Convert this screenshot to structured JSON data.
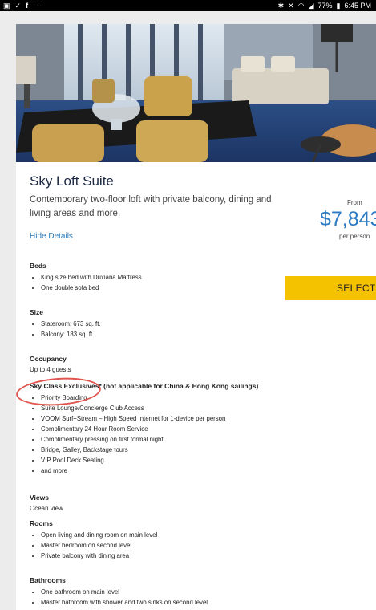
{
  "status_bar": {
    "left_icons": [
      "gallery-icon",
      "check-icon",
      "facebook-icon",
      "more-icon"
    ],
    "right_icons": [
      "bluetooth-icon",
      "mute-icon",
      "wifi-icon",
      "signal-icon"
    ],
    "battery": "77%",
    "time": "6:45 PM"
  },
  "suite": {
    "title": "Sky Loft Suite",
    "description": "Contemporary two-floor loft with private balcony, dining and living areas and more.",
    "hide_details": "Hide Details"
  },
  "pricing": {
    "from": "From",
    "price": "$7,843",
    "per": "per person",
    "select": "SELECT"
  },
  "details": {
    "beds": {
      "heading": "Beds",
      "items": [
        "King size bed with Duxiana Mattress",
        "One double sofa bed"
      ]
    },
    "size": {
      "heading": "Size",
      "items": [
        "Stateroom: 673 sq. ft.",
        "Balcony: 183 sq. ft."
      ]
    },
    "occupancy": {
      "heading": "Occupancy",
      "value": "Up to 4 guests"
    },
    "exclusives": {
      "heading": "Sky Class Exclusives* (not applicable for China & Hong Kong sailings)",
      "items": [
        "Priority Boarding",
        "Suite Lounge/Concierge Club Access",
        "VOOM Surf+Stream – High Speed Internet for 1-device per person",
        "Complimentary 24 Hour Room Service",
        "Complimentary pressing on first formal night",
        "Bridge, Galley, Backstage tours",
        "VIP Pool Deck Seating",
        "and more"
      ]
    },
    "views": {
      "heading": "Views",
      "value": "Ocean view"
    },
    "rooms": {
      "heading": "Rooms",
      "items": [
        "Open living and dining room on main level",
        "Master bedroom on second level",
        "Private balcony with dining area"
      ]
    },
    "bathrooms": {
      "heading": "Bathrooms",
      "items": [
        "One bathroom on main level",
        "Master bathroom with shower and two sinks on second level"
      ]
    }
  }
}
